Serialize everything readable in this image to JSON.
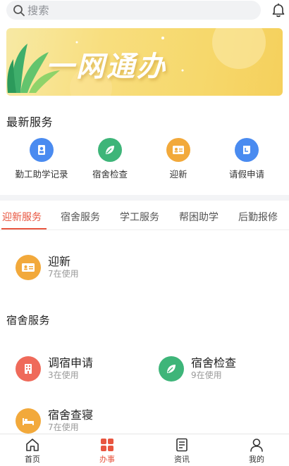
{
  "search": {
    "placeholder": "搜索"
  },
  "banner": {
    "title": "一网通办"
  },
  "latest": {
    "title": "最新服务",
    "items": [
      {
        "label": "勤工助学记录",
        "icon": "student-id-icon",
        "color": "#4a8bf0"
      },
      {
        "label": "宿舍检查",
        "icon": "leaf-icon",
        "color": "#3eb579"
      },
      {
        "label": "迎新",
        "icon": "id-card-icon",
        "color": "#f2a93b"
      },
      {
        "label": "请假申请",
        "icon": "leave-note-icon",
        "color": "#4a8bf0"
      }
    ]
  },
  "tabs": [
    "迎新服务",
    "宿舍服务",
    "学工服务",
    "帮困助学",
    "后勤报修"
  ],
  "tab_active": "迎新服务",
  "welcome": {
    "items": [
      {
        "name": "迎新",
        "count": "7在使用",
        "icon": "id-card-icon",
        "color": "#f2a93b"
      }
    ]
  },
  "dorm": {
    "title": "宿舍服务",
    "items": [
      {
        "name": "调宿申请",
        "count": "3在使用",
        "icon": "building-icon",
        "color": "#ef6a5a"
      },
      {
        "name": "宿舍检查",
        "count": "9在使用",
        "icon": "leaf-icon",
        "color": "#3eb579"
      },
      {
        "name": "宿舍查寝",
        "count": "7在使用",
        "icon": "bed-icon",
        "color": "#f2a93b"
      }
    ]
  },
  "nav": [
    {
      "label": "首页",
      "icon": "home-icon"
    },
    {
      "label": "办事",
      "icon": "grid-icon"
    },
    {
      "label": "资讯",
      "icon": "news-icon"
    },
    {
      "label": "我的",
      "icon": "user-icon"
    }
  ],
  "nav_active": "办事",
  "colors": {
    "accent": "#e8553f",
    "search_bg": "#f1f2f4",
    "banner_yellow": "#f6d86c"
  }
}
